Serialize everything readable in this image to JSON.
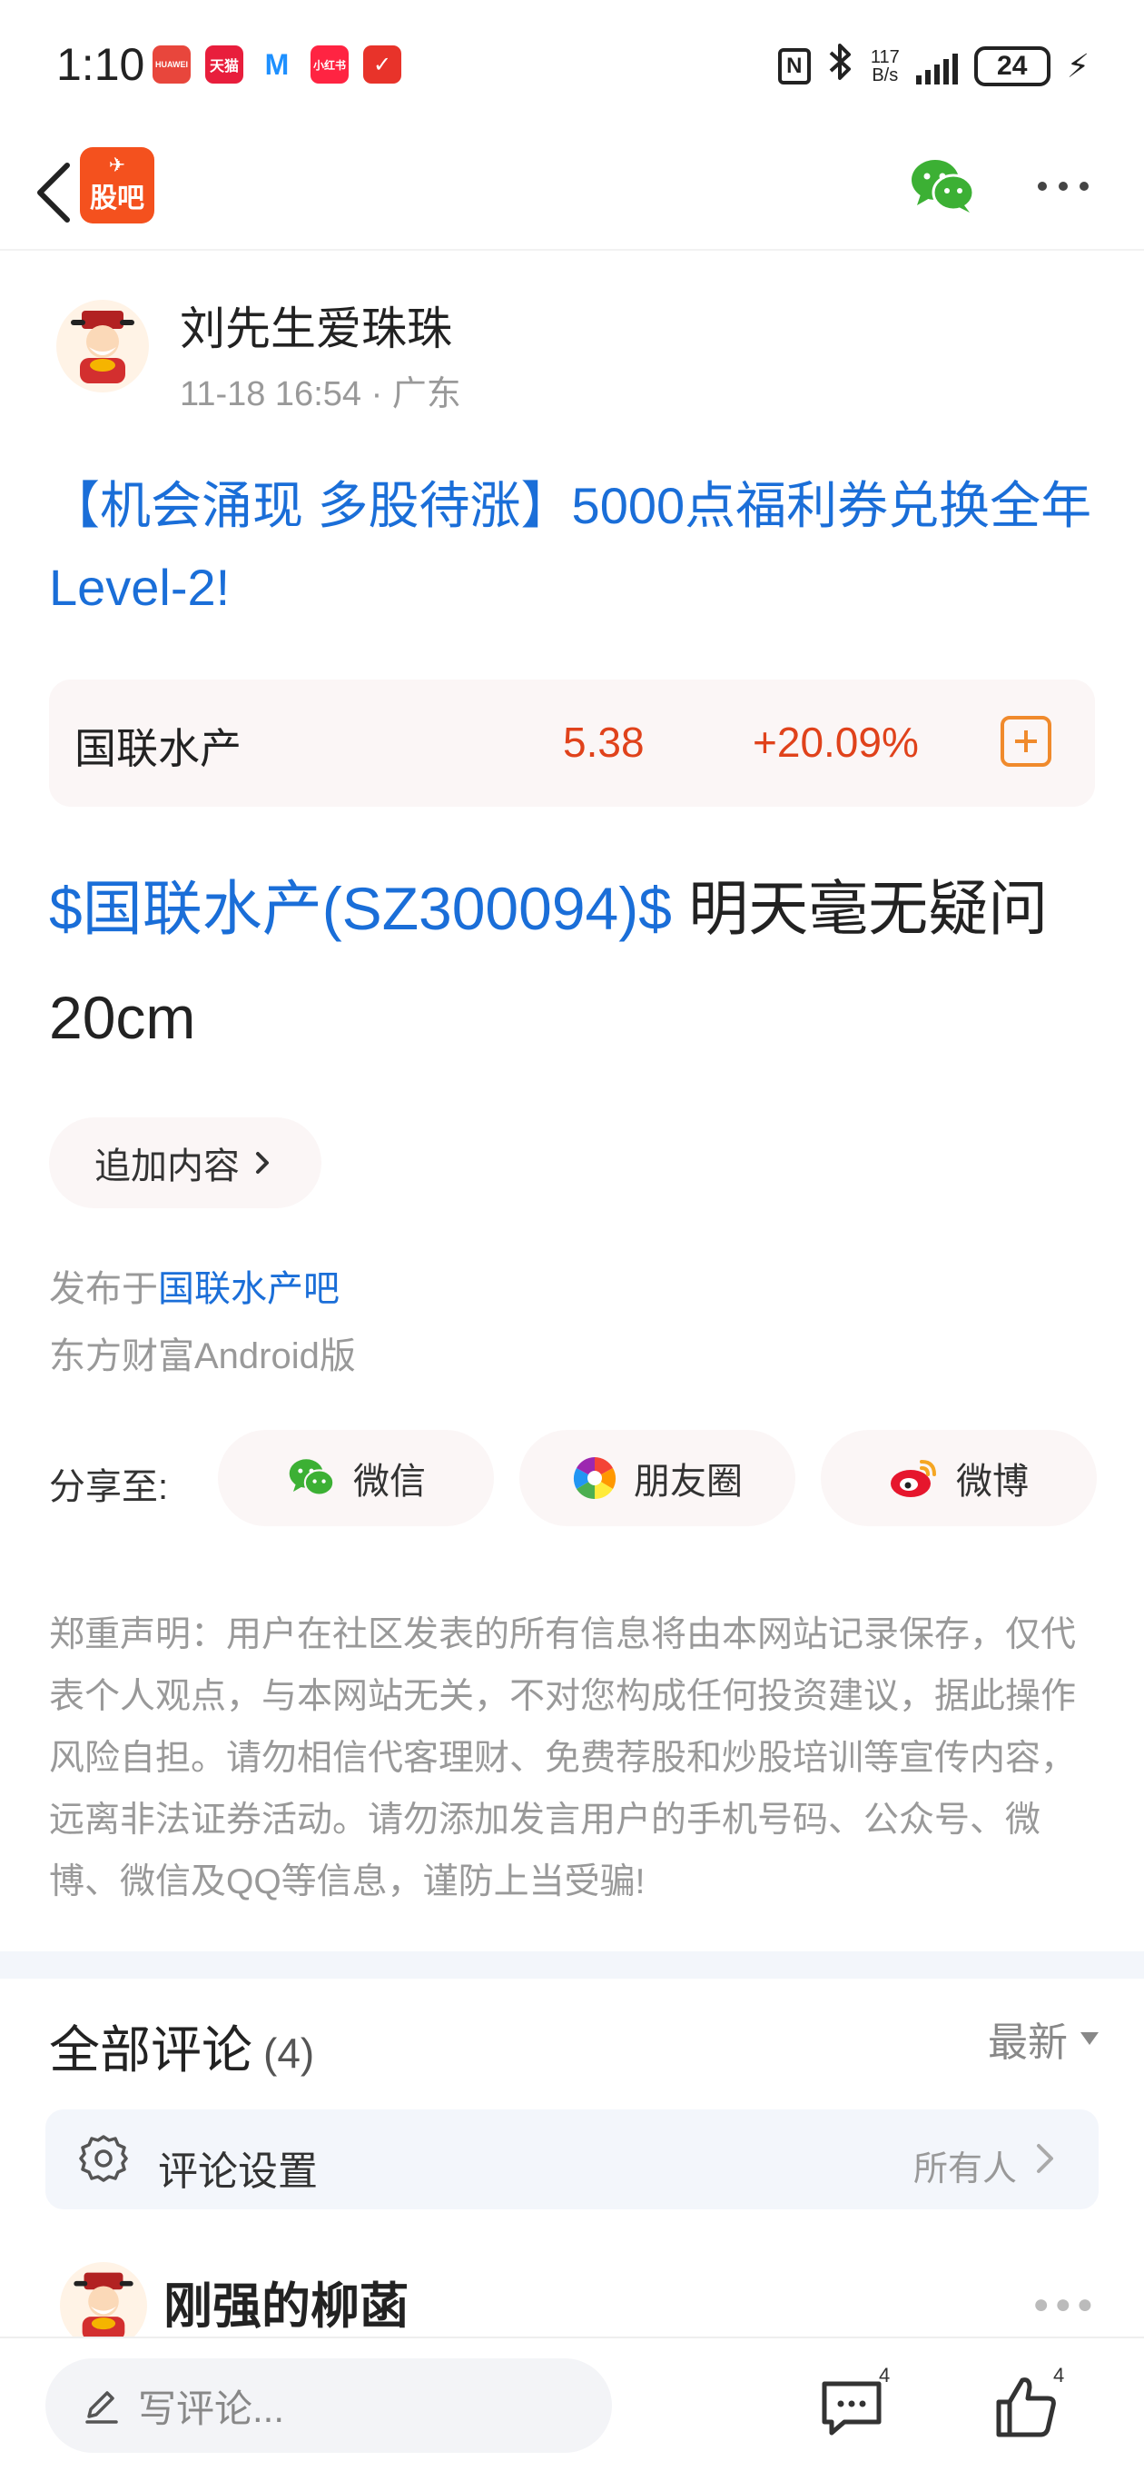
{
  "status_bar": {
    "time": "1:10",
    "notifications": [
      {
        "name": "huawei",
        "label": "HUAWEI",
        "color": "#e8463c"
      },
      {
        "name": "tmall",
        "label": "天猫",
        "color": "#e81e3c"
      },
      {
        "name": "meitu",
        "label": "M",
        "color": "#1e90ff"
      },
      {
        "name": "xiaohongshu",
        "label": "小红书",
        "color": "#ff2442"
      },
      {
        "name": "app",
        "label": "✓",
        "color": "#e8332a"
      }
    ],
    "nfc": "N",
    "net_speed_value": "117",
    "net_speed_unit": "B/s",
    "battery": "24"
  },
  "topbar": {
    "logo_label": "股吧"
  },
  "post": {
    "author": "刘先生爱珠珠",
    "meta": "11-18 16:54 · 广东",
    "title": "【机会涌现 多股待涨】5000点福利券兑换全年Level-2!",
    "stock": {
      "name": "国联水产",
      "price": "5.38",
      "change": "+20.09%"
    },
    "body_tag": "$国联水产(SZ300094)$",
    "body_text": " 明天毫无疑问20cm",
    "append_label": "追加内容",
    "published_prefix": "发布于",
    "published_bar": "国联水产吧",
    "client": "东方财富Android版"
  },
  "share": {
    "label": "分享至:",
    "targets": [
      {
        "label": "微信",
        "icon": "wechat-icon"
      },
      {
        "label": "朋友圈",
        "icon": "moments-icon"
      },
      {
        "label": "微博",
        "icon": "weibo-icon"
      }
    ]
  },
  "disclaimer": "郑重声明：用户在社区发表的所有信息将由本网站记录保存，仅代表个人观点，与本网站无关，不对您构成任何投资建议，据此操作风险自担。请勿相信代客理财、免费荐股和炒股培训等宣传内容，远离非法证券活动。请勿添加发言用户的手机号码、公众号、微博、微信及QQ等信息，谨防上当受骗!",
  "comments": {
    "title": "全部评论",
    "count": "(4)",
    "sort": "最新",
    "settings_label": "评论设置",
    "settings_value": "所有人",
    "first_commenter": "刚强的柳菡"
  },
  "bottom_bar": {
    "input_placeholder": "写评论...",
    "comment_count": "4",
    "like_count": "4"
  }
}
